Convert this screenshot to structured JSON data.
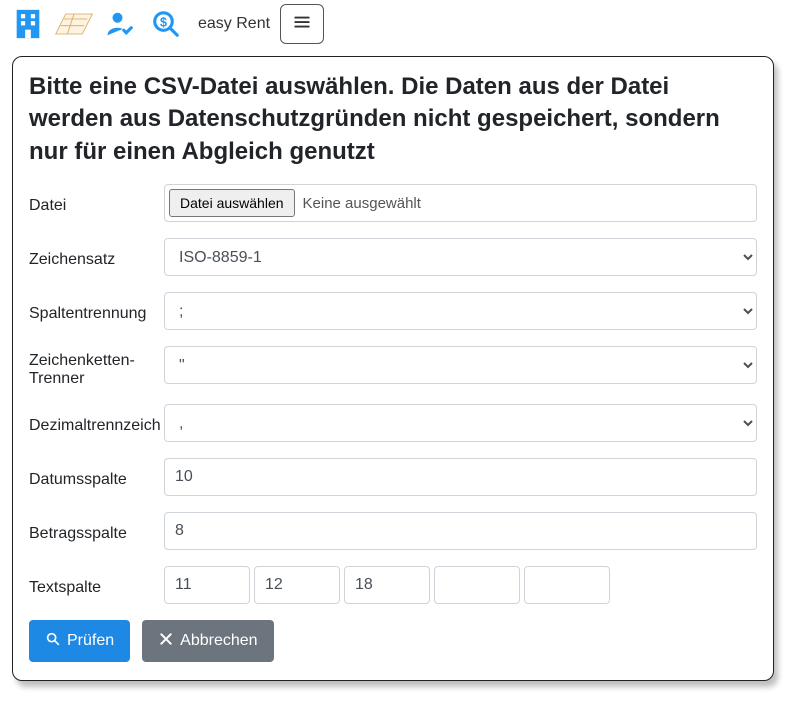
{
  "topbar": {
    "brand": "easy Rent"
  },
  "card": {
    "title": "Bitte eine CSV-Datei auswählen. Die Daten aus der Datei werden aus Datenschutzgründen nicht gespeichert, sondern nur für einen Abgleich genutzt",
    "file": {
      "label": "Datei",
      "button": "Datei auswählen",
      "status": "Keine ausgewählt"
    },
    "charset": {
      "label": "Zeichensatz",
      "value": "ISO-8859-1"
    },
    "separator": {
      "label": "Spaltentrennung",
      "value": ";"
    },
    "string_delim": {
      "label": "Zeichenketten-Trenner",
      "value": "\""
    },
    "decimal": {
      "label": "Dezimaltrennzeich",
      "value": ","
    },
    "date_col": {
      "label": "Datumsspalte",
      "value": "10"
    },
    "amount_col": {
      "label": "Betragsspalte",
      "value": "8"
    },
    "text_col": {
      "label": "Textspalte",
      "v1": "11",
      "v2": "12",
      "v3": "18",
      "v4": "",
      "v5": ""
    },
    "actions": {
      "check": "Prüfen",
      "cancel": "Abbrechen"
    }
  }
}
